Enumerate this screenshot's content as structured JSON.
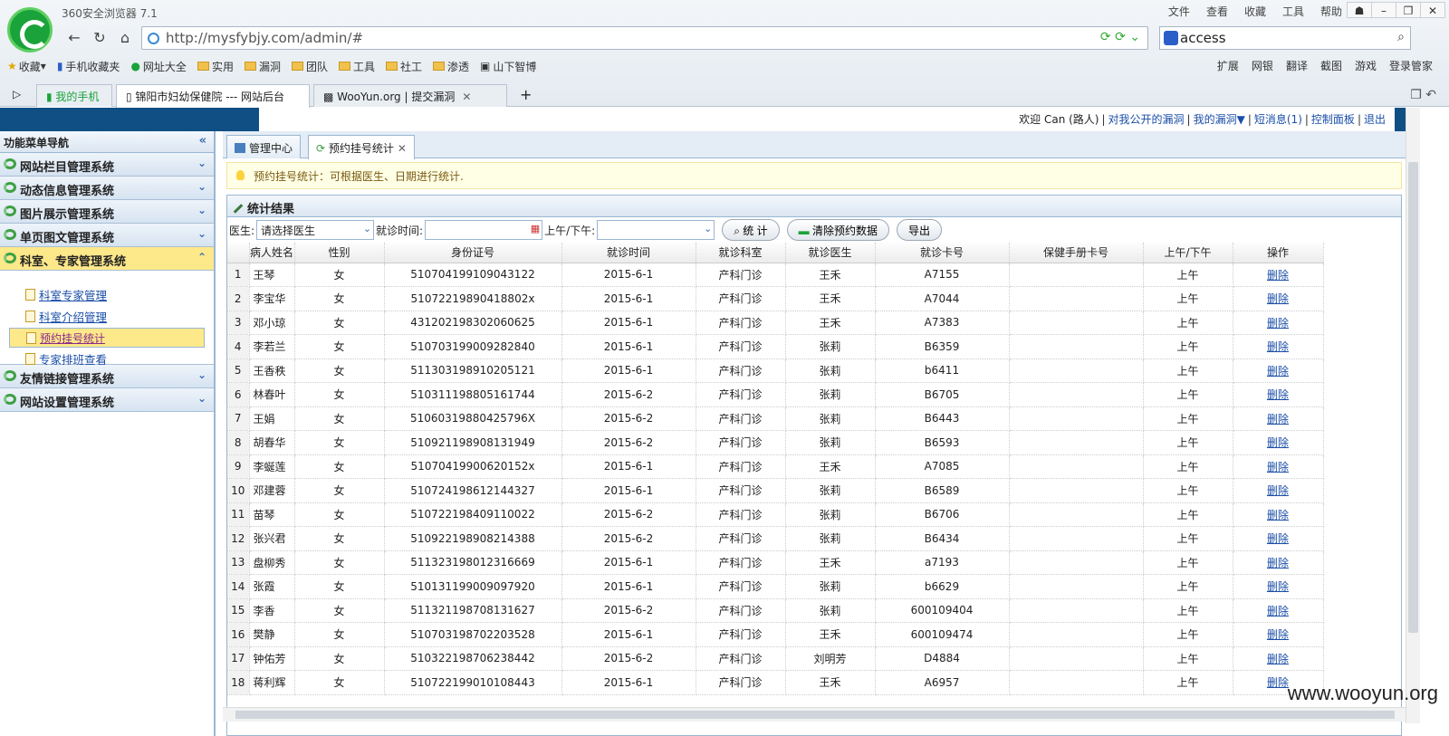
{
  "browser": {
    "title": "360安全浏览器 7.1",
    "menu": [
      "文件",
      "查看",
      "收藏",
      "工具",
      "帮助"
    ],
    "url": "http://mysfybjy.com/admin/#",
    "search_text": "access",
    "favorites": [
      "收藏",
      "手机收藏夹",
      "网址大全",
      "实用",
      "漏洞",
      "团队",
      "工具",
      "社工",
      "渗透",
      "山下智博"
    ],
    "fav_right": [
      "扩展",
      "网银",
      "翻译",
      "截图",
      "游戏",
      "登录管家"
    ],
    "tabs": [
      "我的手机",
      "锦阳市妇幼保健院 --- 网站后台",
      "WooYun.org | 提交漏洞"
    ]
  },
  "userbar": {
    "welcome": "欢迎 Can (路人)",
    "links": [
      "对我公开的漏洞",
      "我的漏洞▼",
      "短消息(1)",
      "控制面板",
      "退出"
    ]
  },
  "sidebar": {
    "title": "功能菜单导航",
    "sections": [
      "网站栏目管理系统",
      "动态信息管理系统",
      "图片展示管理系统",
      "单页图文管理系统",
      "科室、专家管理系统",
      "友情链接管理系统",
      "网站设置管理系统"
    ],
    "items": [
      "科室专家管理",
      "科室介绍管理",
      "预约挂号统计",
      "专家排班查看"
    ]
  },
  "content_tabs": [
    "管理中心",
    "预约挂号统计"
  ],
  "tip": "预约挂号统计：可根据医生、日期进行统计.",
  "result_title": "统计结果",
  "filter": {
    "doctor_label": "医生:",
    "doctor_value": "请选择医生",
    "date_label": "就诊时间:",
    "ampm_label": "上午/下午:",
    "btn_stat": "统 计",
    "btn_clear": "清除预约数据",
    "btn_export": "导出"
  },
  "table": {
    "headers": [
      "",
      "病人姓名",
      "性别",
      "身份证号",
      "就诊时间",
      "就诊科室",
      "就诊医生",
      "就诊卡号",
      "保健手册卡号",
      "上午/下午",
      "操作"
    ],
    "rows": [
      [
        "1",
        "王琴",
        "女",
        "510704199109043122",
        "2015-6-1",
        "产科门诊",
        "王禾",
        "A7155",
        "",
        "上午",
        "删除"
      ],
      [
        "2",
        "李宝华",
        "女",
        "51072219890418802x",
        "2015-6-1",
        "产科门诊",
        "王禾",
        "A7044",
        "",
        "上午",
        "删除"
      ],
      [
        "3",
        "邓小琼",
        "女",
        "431202198302060625",
        "2015-6-1",
        "产科门诊",
        "王禾",
        "A7383",
        "",
        "上午",
        "删除"
      ],
      [
        "4",
        "李若兰",
        "女",
        "510703199009282840",
        "2015-6-1",
        "产科门诊",
        "张莉",
        "B6359",
        "",
        "上午",
        "删除"
      ],
      [
        "5",
        "王香秩",
        "女",
        "511303198910205121",
        "2015-6-1",
        "产科门诊",
        "张莉",
        "b6411",
        "",
        "上午",
        "删除"
      ],
      [
        "6",
        "林春叶",
        "女",
        "510311198805161744",
        "2015-6-2",
        "产科门诊",
        "张莉",
        "B6705",
        "",
        "上午",
        "删除"
      ],
      [
        "7",
        "王娟",
        "女",
        "51060319880425796X",
        "2015-6-2",
        "产科门诊",
        "张莉",
        "B6443",
        "",
        "上午",
        "删除"
      ],
      [
        "8",
        "胡春华",
        "女",
        "510921198908131949",
        "2015-6-2",
        "产科门诊",
        "张莉",
        "B6593",
        "",
        "上午",
        "删除"
      ],
      [
        "9",
        "李蜒莲",
        "女",
        "51070419900620152x",
        "2015-6-1",
        "产科门诊",
        "王禾",
        "A7085",
        "",
        "上午",
        "删除"
      ],
      [
        "10",
        "邓建蓉",
        "女",
        "510724198612144327",
        "2015-6-1",
        "产科门诊",
        "张莉",
        "B6589",
        "",
        "上午",
        "删除"
      ],
      [
        "11",
        "苗琴",
        "女",
        "510722198409110022",
        "2015-6-2",
        "产科门诊",
        "张莉",
        "B6706",
        "",
        "上午",
        "删除"
      ],
      [
        "12",
        "张兴君",
        "女",
        "510922198908214388",
        "2015-6-2",
        "产科门诊",
        "张莉",
        "B6434",
        "",
        "上午",
        "删除"
      ],
      [
        "13",
        "盘柳秀",
        "女",
        "511323198012316669",
        "2015-6-1",
        "产科门诊",
        "王禾",
        "a7193",
        "",
        "上午",
        "删除"
      ],
      [
        "14",
        "张霞",
        "女",
        "510131199009097920",
        "2015-6-1",
        "产科门诊",
        "张莉",
        "b6629",
        "",
        "上午",
        "删除"
      ],
      [
        "15",
        "李香",
        "女",
        "511321198708131627",
        "2015-6-2",
        "产科门诊",
        "张莉",
        "600109404",
        "",
        "上午",
        "删除"
      ],
      [
        "16",
        "樊静",
        "女",
        "510703198702203528",
        "2015-6-1",
        "产科门诊",
        "王禾",
        "600109474",
        "",
        "上午",
        "删除"
      ],
      [
        "17",
        "钟佑芳",
        "女",
        "510322198706238442",
        "2015-6-2",
        "产科门诊",
        "刘明芳",
        "D4884",
        "",
        "上午",
        "删除"
      ],
      [
        "18",
        "蒋利辉",
        "女",
        "510722199010108443",
        "2015-6-1",
        "产科门诊",
        "王禾",
        "A6957",
        "",
        "上午",
        "删除"
      ]
    ]
  },
  "watermark": "www.wooyun.org"
}
